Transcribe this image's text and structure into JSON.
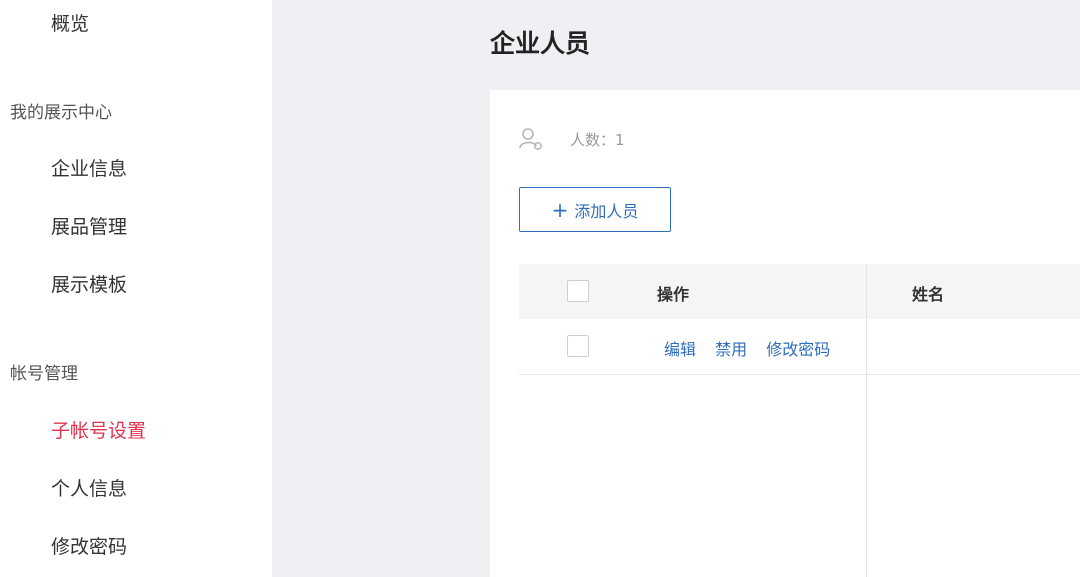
{
  "sidebar": {
    "overview": "概览",
    "groups": [
      {
        "label": "我的展示中心",
        "items": [
          "企业信息",
          "展品管理",
          "展示模板"
        ]
      },
      {
        "label": "帐号管理",
        "items": [
          "子帐号设置",
          "个人信息",
          "修改密码"
        ]
      }
    ],
    "active_item": "子帐号设置"
  },
  "main": {
    "title": "企业人员",
    "member_count": "人数：1",
    "add_button": "添加人员",
    "table": {
      "columns": [
        "操作",
        "姓名"
      ],
      "rows": [
        {
          "actions": [
            "编辑",
            "禁用",
            "修改密码"
          ],
          "name": ""
        }
      ]
    }
  },
  "colors": {
    "accent": "#2f6ebd",
    "active": "#e2344f",
    "background": "#eef0f3"
  },
  "icons": {
    "count_icon": "user-settings-icon",
    "add_icon": "plus-icon"
  }
}
